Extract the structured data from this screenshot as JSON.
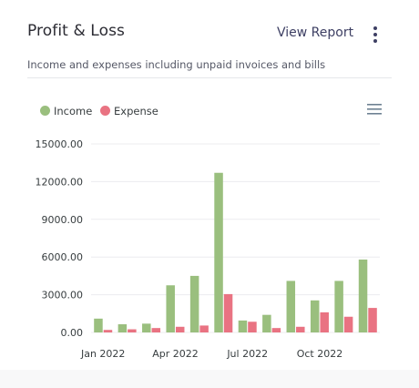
{
  "header": {
    "title": "Profit & Loss",
    "view_report_label": "View Report",
    "subtitle": "Income and expenses including unpaid invoices and bills"
  },
  "icons": {
    "more": "vertical-ellipsis-icon",
    "menu": "hamburger-menu-icon"
  },
  "colors": {
    "income": "#9abf7e",
    "expense": "#e97382"
  },
  "chart_data": {
    "type": "bar",
    "categories": [
      "Jan 2022",
      "Feb 2022",
      "Mar 2022",
      "Apr 2022",
      "May 2022",
      "Jun 2022",
      "Jul 2022",
      "Aug 2022",
      "Sep 2022",
      "Oct 2022",
      "Nov 2022",
      "Dec 2022"
    ],
    "x_tick_labels": [
      "Jan 2022",
      "Apr 2022",
      "Jul 2022",
      "Oct 2022"
    ],
    "y_tick_labels": [
      "0.00",
      "3000.00",
      "6000.00",
      "9000.00",
      "12000.00",
      "15000.00"
    ],
    "ylim": [
      0,
      15000
    ],
    "grid": true,
    "legend_position": "top-left",
    "series": [
      {
        "name": "Income",
        "values": [
          1100,
          650,
          700,
          3750,
          4500,
          12700,
          950,
          1400,
          4100,
          2550,
          4100,
          5800
        ]
      },
      {
        "name": "Expense",
        "values": [
          200,
          250,
          350,
          450,
          550,
          3050,
          850,
          350,
          450,
          1600,
          1250,
          1950
        ]
      }
    ]
  }
}
